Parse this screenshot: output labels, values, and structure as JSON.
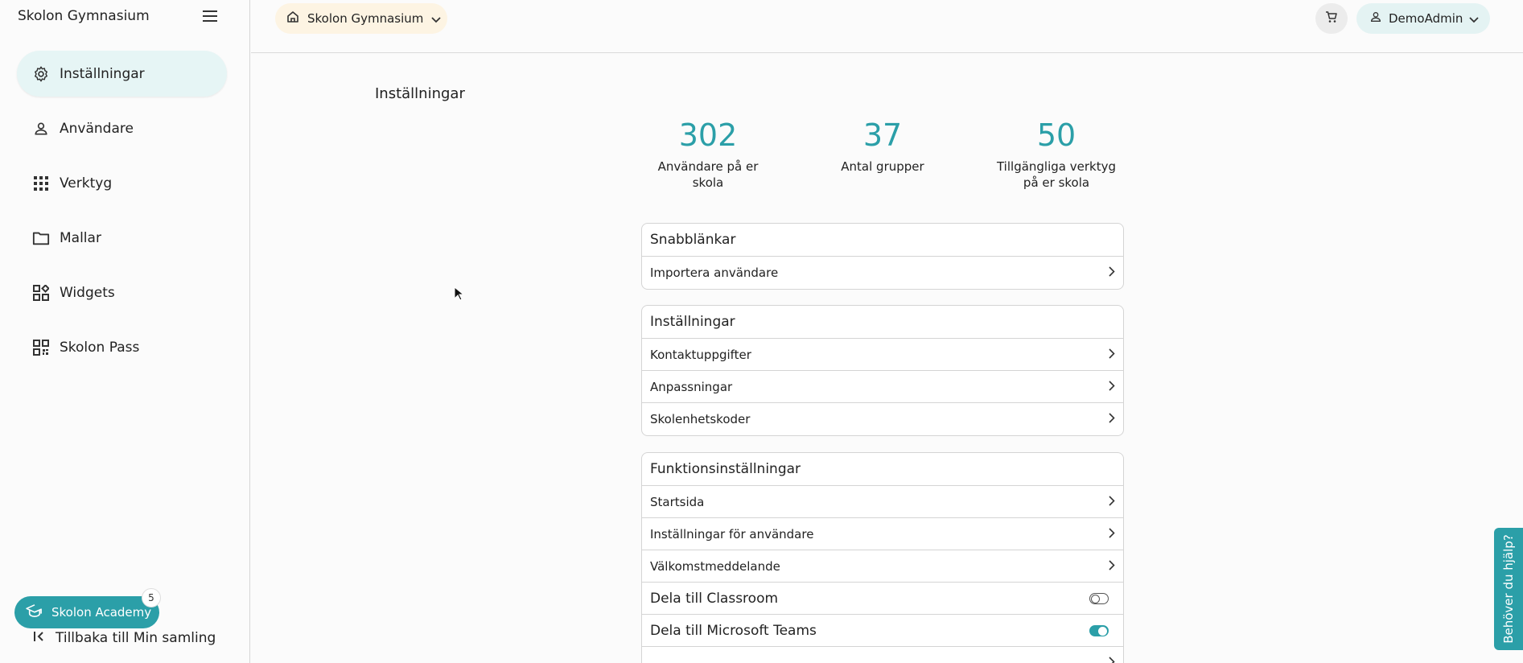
{
  "sidebar": {
    "school_name": "Skolon Gymnasium",
    "items": [
      {
        "label": "Inställningar",
        "icon": "gear-icon",
        "active": true
      },
      {
        "label": "Användare",
        "icon": "person-icon",
        "active": false
      },
      {
        "label": "Verktyg",
        "icon": "grid-icon",
        "active": false
      },
      {
        "label": "Mallar",
        "icon": "folder-icon",
        "active": false
      },
      {
        "label": "Widgets",
        "icon": "widgets-icon",
        "active": false
      },
      {
        "label": "Skolon Pass",
        "icon": "qr-icon",
        "active": false
      }
    ],
    "academy_label": "Skolon Academy",
    "academy_badge": "5",
    "back_label": "Tillbaka till Min samling"
  },
  "topbar": {
    "school_selector": "Skolon Gymnasium",
    "user_label": "DemoAdmin"
  },
  "main": {
    "title": "Inställningar",
    "stats": [
      {
        "value": "302",
        "caption_line1": "Användare på er",
        "caption_line2": "skola"
      },
      {
        "value": "37",
        "caption_line1": "Antal grupper",
        "caption_line2": ""
      },
      {
        "value": "50",
        "caption_line1": "Tillgängliga verktyg",
        "caption_line2": "på er skola"
      }
    ],
    "cards": [
      {
        "title": "Snabblänkar",
        "rows": [
          "Importera användare"
        ]
      },
      {
        "title": "Inställningar",
        "rows": [
          "Kontaktuppgifter",
          "Anpassningar",
          "Skolenhetskoder"
        ]
      },
      {
        "title": "Funktionsinställningar",
        "rows": [
          "Startsida",
          "Inställningar för användare",
          "Välkomstmeddelande"
        ],
        "toggles": [
          {
            "label": "Dela till Classroom",
            "on": false
          },
          {
            "label": "Dela till Microsoft Teams",
            "on": true
          }
        ]
      }
    ]
  },
  "help_tab": "Behöver du hjälp?",
  "colors": {
    "accent": "#2b9fa8",
    "school_pill": "#fdf4e3",
    "active_nav": "#e6f5f5"
  }
}
